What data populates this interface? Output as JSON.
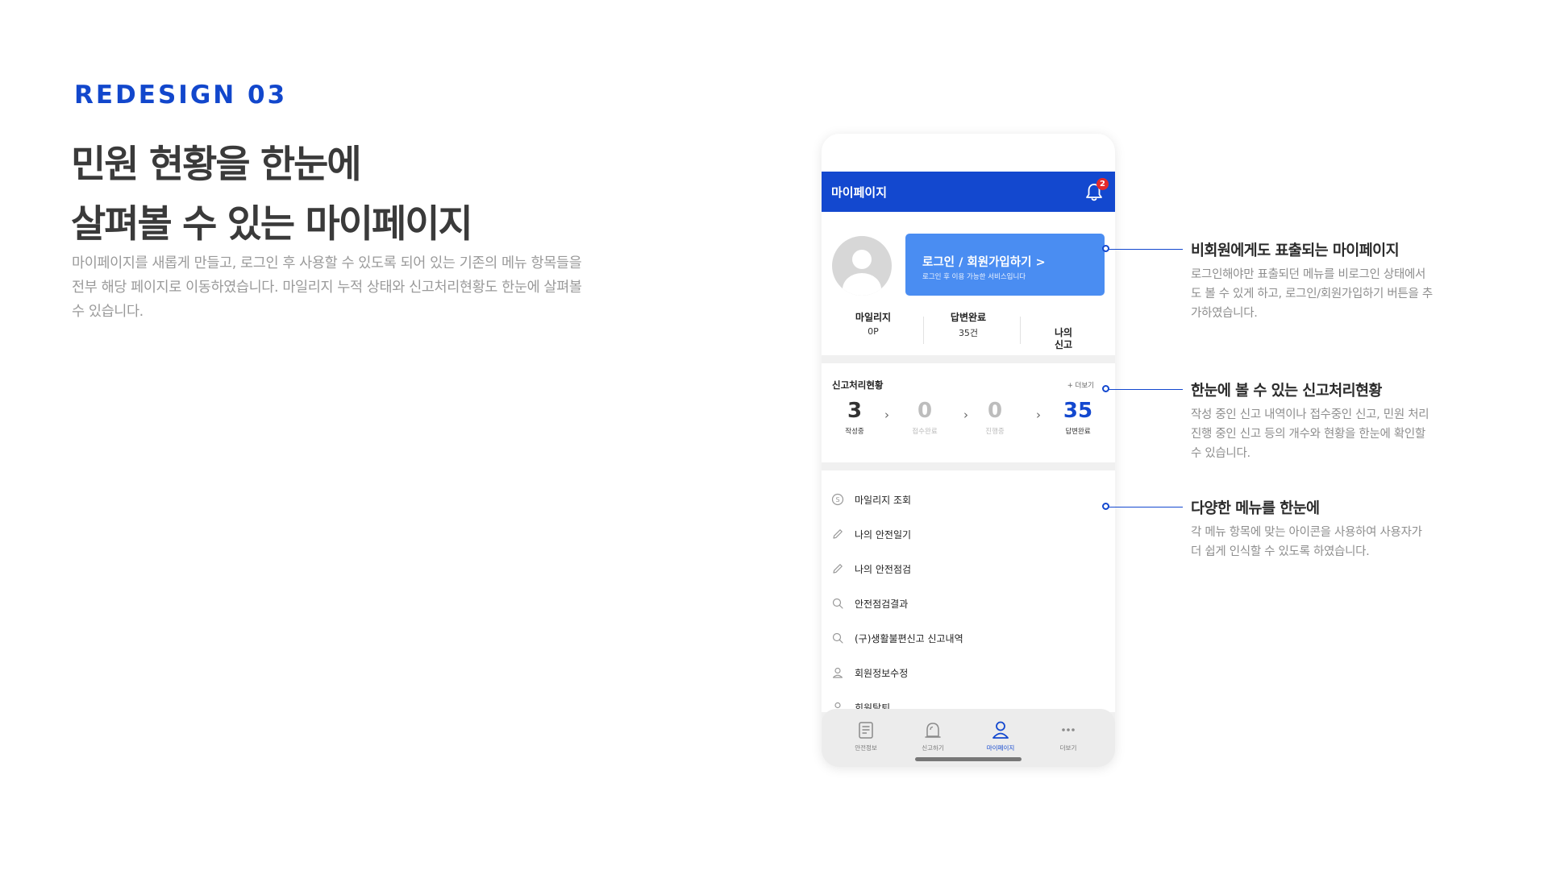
{
  "hero": {
    "tag": "REDESIGN 03",
    "headline_line1": "민원 현황을 한눈에",
    "headline_line2": "살펴볼 수 있는 마이페이지",
    "description": "마이페이지를 새롭게 만들고, 로그인 후 사용할 수 있도록 되어 있는 기존의 메뉴 항목들을 전부 해당 페이지로 이동하였습니다. 마일리지 누적 상태와 신고처리현황도 한눈에 살펴볼 수 있습니다."
  },
  "phone": {
    "appbar_title": "마이페이지",
    "notification_count": "2",
    "login_button_label": "로그인 / 회원가입하기  >",
    "login_button_sub": "로그인 후 이용 가능한 서비스입니다",
    "stats": [
      {
        "label": "마일리지",
        "value": "0P"
      },
      {
        "label": "답변완료",
        "value": "35건"
      },
      {
        "label": "나의\n신고",
        "value": ""
      }
    ],
    "process": {
      "title": "신고처리현황",
      "more_label": "+ 더보기",
      "steps": [
        {
          "count": "3",
          "label": "작성중"
        },
        {
          "count": "0",
          "label": "접수완료"
        },
        {
          "count": "0",
          "label": "진행중"
        },
        {
          "count": "35",
          "label": "답변완료"
        }
      ]
    },
    "menu": [
      {
        "label": "마일리지 조회",
        "icon": "coin-icon"
      },
      {
        "label": "나의 안전일기",
        "icon": "pencil-icon"
      },
      {
        "label": "나의 안전점검",
        "icon": "pencil-icon"
      },
      {
        "label": "안전점검결과",
        "icon": "search-icon"
      },
      {
        "label": "(구)생활불편신고 신고내역",
        "icon": "search-icon"
      },
      {
        "label": "회원정보수정",
        "icon": "person-icon"
      },
      {
        "label": "회원탈퇴",
        "icon": "person-icon"
      }
    ],
    "tabs": [
      {
        "label": "안전정보",
        "icon": "document-icon"
      },
      {
        "label": "신고하기",
        "icon": "siren-icon"
      },
      {
        "label": "마이페이지",
        "icon": "person-icon"
      },
      {
        "label": "더보기",
        "icon": "more-icon"
      }
    ],
    "accent_color": "#1348cf"
  },
  "annotations": [
    {
      "title": "비회원에게도 표출되는 마이페이지",
      "text": "로그인해야만 표출되던 메뉴를 비로그인 상태에서도 볼 수 있게 하고, 로그인/회원가입하기 버튼을 추가하였습니다."
    },
    {
      "title": "한눈에 볼 수 있는 신고처리현황",
      "text": "작성 중인 신고 내역이나 접수중인 신고, 민원 처리 진행 중인 신고 등의 개수와 현황을 한눈에 확인할 수 있습니다."
    },
    {
      "title": "다양한 메뉴를 한눈에",
      "text": "각 메뉴 항목에 맞는 아이콘을 사용하여 사용자가 더 쉽게 인식할 수 있도록 하였습니다."
    }
  ]
}
